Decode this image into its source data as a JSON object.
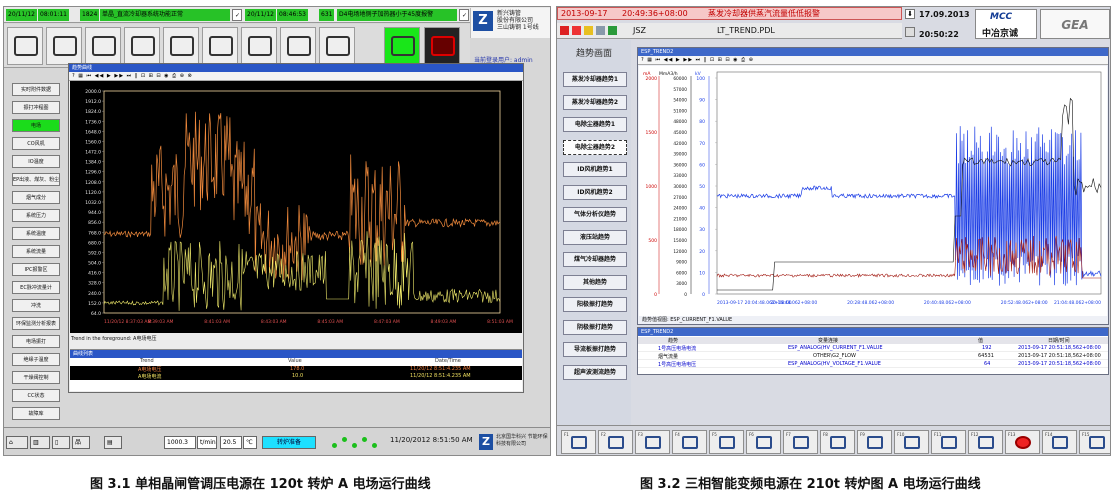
{
  "left": {
    "alarm": {
      "date1": "20/11/12",
      "time1": "08:01:11",
      "code1": "1824",
      "msg1": "单晶_直流冷却器系统功能正常",
      "date2": "20/11/12",
      "time2": "08:46:53",
      "code2": "631",
      "msg2": "D4电场地侧子加热器小于45度报警"
    },
    "company": {
      "line1": "新兴铸管",
      "line2": "股份有限公司",
      "line3": "三山铸钢 1号线"
    },
    "user": "当前登录用户:   admin",
    "sidebar": [
      "实时附件数据",
      "振打冲程图",
      "电场",
      "CO风机",
      "IO温度",
      "EP出液、煤灰、粉尘",
      "烟气成分",
      "系统压力",
      "系统温度",
      "系统流量",
      "IPC报警区",
      "EC脉冲流量计",
      "冲洗",
      "环保监测分析报表",
      "电场振打",
      "绝缘子温度",
      "干燥阀控制",
      "CC状态",
      "故障库"
    ],
    "active_index": 2,
    "window_title": "趋势曲线",
    "plot_caption": "Trend in the foreground: A电场电压",
    "legend": {
      "title": "曲线列表",
      "headers": [
        "Trend",
        "Value",
        "Date/Time"
      ],
      "rows": [
        {
          "trend": "A电场电压",
          "value": "178.0",
          "time": "11/20/12 8:51:4.235 AM"
        },
        {
          "trend": "A电场电流",
          "value": "10.0",
          "time": "11/20/12 8:51:4.235 AM"
        }
      ]
    },
    "status": {
      "flow": "1000.3",
      "flow_unit": "t/min",
      "temp": "20.5",
      "temp_unit": "℃",
      "state": "转炉准备",
      "clock": "11/20/2012 8:51:50 AM",
      "vendor": "北京国华科兴 节能环保科技有限公司"
    },
    "axis": {
      "left_ticks": [
        "2000.0",
        "1912.0",
        "1824.0",
        "1736.0",
        "1648.0",
        "1560.0",
        "1472.0",
        "1384.0",
        "1296.0",
        "1208.0",
        "1120.0",
        "1032.0",
        "944.0",
        "856.0",
        "768.0",
        "680.0",
        "592.0",
        "504.0",
        "416.0",
        "328.0",
        "240.0",
        "152.0",
        "64.0"
      ],
      "time_ticks": [
        "11/20/12 8:37:03 AM",
        "8:39:03 AM",
        "8:41:03 AM",
        "8:43:03 AM",
        "8:45:03 AM",
        "8:47:03 AM",
        "8:49:03 AM",
        "8:51:03 AM"
      ]
    }
  },
  "right": {
    "alarm": {
      "date": "2013-09-17",
      "time": "20:49:36+08:00",
      "msg": "蒸发冷却器供蒸汽流量低低报警"
    },
    "clock_date": "17.09.2013",
    "clock_time": "20:50:22",
    "logo1_a": "MCC",
    "logo1_b": "中冶京诚",
    "logo2": "GEA",
    "station": "JSZ",
    "pdl": "LT_TREND.PDL",
    "side_title": "趋势画面",
    "sidebar": [
      "蒸发冷却器趋势1",
      "蒸发冷却器趋势2",
      "电除尘器趋势1",
      "电除尘器趋势2",
      "ID风机趋势1",
      "ID风机趋势2",
      "气体分析仪趋势",
      "液压站趋势",
      "煤气冷却器趋势",
      "其他趋势",
      "阳极振打趋势",
      "阴极振打趋势",
      "导流板振打趋势",
      "超声波测流趋势"
    ],
    "active_index": 3,
    "window_title": "ESP_TREND2",
    "plot_caption": "趋势值视图:  ESP_CURRENT_F1.VALUE",
    "units": [
      "mA",
      "MmA3/h",
      "kV"
    ],
    "ticks_a": [
      "2000",
      "1500",
      "1000",
      "500",
      "0"
    ],
    "ticks_b": [
      "60000",
      "57000",
      "54000",
      "51000",
      "48000",
      "45000",
      "42000",
      "39000",
      "36000",
      "33000",
      "30000",
      "27000",
      "24000",
      "21000",
      "18000",
      "15000",
      "12000",
      "9000",
      "6000",
      "3000",
      "0"
    ],
    "ticks_c": [
      "100",
      "90",
      "80",
      "70",
      "60",
      "50",
      "40",
      "30",
      "20",
      "10",
      "0"
    ],
    "time_ticks": [
      "2013-09-17 20:04:48.062+08:00",
      "20:16:48.062+08:00",
      "20:28:48.062+08:00",
      "20:40:48.062+08:00",
      "20:52:48.062+08:00",
      "21:04:48.062+08:00"
    ],
    "table": {
      "title": "ESP_TREND2",
      "headers": [
        "趋势",
        "变量连接",
        "值",
        "日期/时间"
      ],
      "rows": [
        {
          "name": "1号高压电场电流",
          "tag": "ESP_ANALOG(HV_CURRENT_F1.VALUE",
          "value": "192",
          "time": "2013-09-17 20:51:18,562+08:00"
        },
        {
          "name": "烟气流量",
          "tag": "OTHER\\G2_FLOW",
          "value": "64531",
          "time": "2013-09-17 20:51:18,562+08:00"
        },
        {
          "name": "1号高压电场电压",
          "tag": "ESP_ANALOG(HV_VOLTAGE_F1.VALUE",
          "value": "64",
          "time": "2013-09-17 20:51:18,562+08:00"
        }
      ]
    }
  },
  "captions": {
    "left": "图 3.1 单相晶闸管调压电源在 120t 转炉 A 电场运行曲线",
    "right": "图 3.2 三相智能变频电源在 210t 转炉图 A 电场运行曲线"
  },
  "colors": {
    "left_voltage": "#f08a3c",
    "left_current": "#f2ec6c",
    "right_current": "#1b3de6",
    "right_flow": "#111111",
    "right_voltage": "#a21a12"
  }
}
